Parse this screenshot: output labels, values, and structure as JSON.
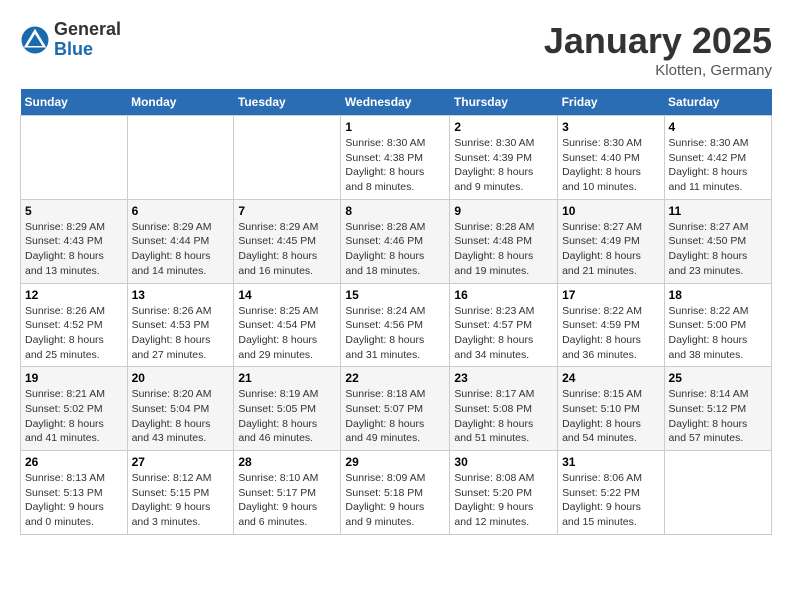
{
  "header": {
    "logo_general": "General",
    "logo_blue": "Blue",
    "month_title": "January 2025",
    "location": "Klotten, Germany"
  },
  "columns": [
    "Sunday",
    "Monday",
    "Tuesday",
    "Wednesday",
    "Thursday",
    "Friday",
    "Saturday"
  ],
  "weeks": [
    [
      {
        "day": "",
        "info": ""
      },
      {
        "day": "",
        "info": ""
      },
      {
        "day": "",
        "info": ""
      },
      {
        "day": "1",
        "info": "Sunrise: 8:30 AM\nSunset: 4:38 PM\nDaylight: 8 hours\nand 8 minutes."
      },
      {
        "day": "2",
        "info": "Sunrise: 8:30 AM\nSunset: 4:39 PM\nDaylight: 8 hours\nand 9 minutes."
      },
      {
        "day": "3",
        "info": "Sunrise: 8:30 AM\nSunset: 4:40 PM\nDaylight: 8 hours\nand 10 minutes."
      },
      {
        "day": "4",
        "info": "Sunrise: 8:30 AM\nSunset: 4:42 PM\nDaylight: 8 hours\nand 11 minutes."
      }
    ],
    [
      {
        "day": "5",
        "info": "Sunrise: 8:29 AM\nSunset: 4:43 PM\nDaylight: 8 hours\nand 13 minutes."
      },
      {
        "day": "6",
        "info": "Sunrise: 8:29 AM\nSunset: 4:44 PM\nDaylight: 8 hours\nand 14 minutes."
      },
      {
        "day": "7",
        "info": "Sunrise: 8:29 AM\nSunset: 4:45 PM\nDaylight: 8 hours\nand 16 minutes."
      },
      {
        "day": "8",
        "info": "Sunrise: 8:28 AM\nSunset: 4:46 PM\nDaylight: 8 hours\nand 18 minutes."
      },
      {
        "day": "9",
        "info": "Sunrise: 8:28 AM\nSunset: 4:48 PM\nDaylight: 8 hours\nand 19 minutes."
      },
      {
        "day": "10",
        "info": "Sunrise: 8:27 AM\nSunset: 4:49 PM\nDaylight: 8 hours\nand 21 minutes."
      },
      {
        "day": "11",
        "info": "Sunrise: 8:27 AM\nSunset: 4:50 PM\nDaylight: 8 hours\nand 23 minutes."
      }
    ],
    [
      {
        "day": "12",
        "info": "Sunrise: 8:26 AM\nSunset: 4:52 PM\nDaylight: 8 hours\nand 25 minutes."
      },
      {
        "day": "13",
        "info": "Sunrise: 8:26 AM\nSunset: 4:53 PM\nDaylight: 8 hours\nand 27 minutes."
      },
      {
        "day": "14",
        "info": "Sunrise: 8:25 AM\nSunset: 4:54 PM\nDaylight: 8 hours\nand 29 minutes."
      },
      {
        "day": "15",
        "info": "Sunrise: 8:24 AM\nSunset: 4:56 PM\nDaylight: 8 hours\nand 31 minutes."
      },
      {
        "day": "16",
        "info": "Sunrise: 8:23 AM\nSunset: 4:57 PM\nDaylight: 8 hours\nand 34 minutes."
      },
      {
        "day": "17",
        "info": "Sunrise: 8:22 AM\nSunset: 4:59 PM\nDaylight: 8 hours\nand 36 minutes."
      },
      {
        "day": "18",
        "info": "Sunrise: 8:22 AM\nSunset: 5:00 PM\nDaylight: 8 hours\nand 38 minutes."
      }
    ],
    [
      {
        "day": "19",
        "info": "Sunrise: 8:21 AM\nSunset: 5:02 PM\nDaylight: 8 hours\nand 41 minutes."
      },
      {
        "day": "20",
        "info": "Sunrise: 8:20 AM\nSunset: 5:04 PM\nDaylight: 8 hours\nand 43 minutes."
      },
      {
        "day": "21",
        "info": "Sunrise: 8:19 AM\nSunset: 5:05 PM\nDaylight: 8 hours\nand 46 minutes."
      },
      {
        "day": "22",
        "info": "Sunrise: 8:18 AM\nSunset: 5:07 PM\nDaylight: 8 hours\nand 49 minutes."
      },
      {
        "day": "23",
        "info": "Sunrise: 8:17 AM\nSunset: 5:08 PM\nDaylight: 8 hours\nand 51 minutes."
      },
      {
        "day": "24",
        "info": "Sunrise: 8:15 AM\nSunset: 5:10 PM\nDaylight: 8 hours\nand 54 minutes."
      },
      {
        "day": "25",
        "info": "Sunrise: 8:14 AM\nSunset: 5:12 PM\nDaylight: 8 hours\nand 57 minutes."
      }
    ],
    [
      {
        "day": "26",
        "info": "Sunrise: 8:13 AM\nSunset: 5:13 PM\nDaylight: 9 hours\nand 0 minutes."
      },
      {
        "day": "27",
        "info": "Sunrise: 8:12 AM\nSunset: 5:15 PM\nDaylight: 9 hours\nand 3 minutes."
      },
      {
        "day": "28",
        "info": "Sunrise: 8:10 AM\nSunset: 5:17 PM\nDaylight: 9 hours\nand 6 minutes."
      },
      {
        "day": "29",
        "info": "Sunrise: 8:09 AM\nSunset: 5:18 PM\nDaylight: 9 hours\nand 9 minutes."
      },
      {
        "day": "30",
        "info": "Sunrise: 8:08 AM\nSunset: 5:20 PM\nDaylight: 9 hours\nand 12 minutes."
      },
      {
        "day": "31",
        "info": "Sunrise: 8:06 AM\nSunset: 5:22 PM\nDaylight: 9 hours\nand 15 minutes."
      },
      {
        "day": "",
        "info": ""
      }
    ]
  ]
}
